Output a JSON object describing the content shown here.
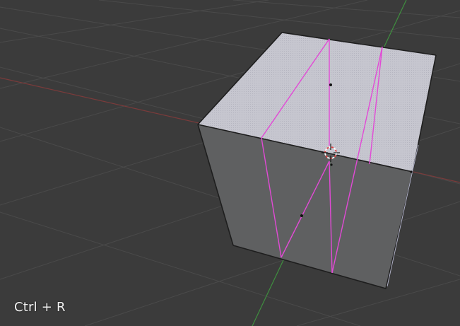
{
  "viewport": {
    "shortcut_hint": "Ctrl + R",
    "background_color": "#3b3b3b",
    "grid_color": "#4a4a4a",
    "x_axis_color": "#7a3b3b",
    "y_axis_color": "#3f8f3f",
    "loop_cut_color": "#e24ad6",
    "cube_top_color": "#c9c9d1",
    "cube_front_color": "#5f6061",
    "cube_side_color": "#9a9bb0",
    "icons": [
      "3d-cursor-icon"
    ]
  }
}
